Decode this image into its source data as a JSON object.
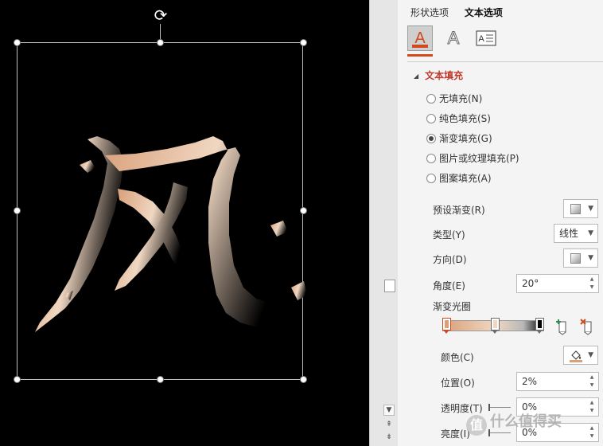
{
  "canvas": {
    "rotate_glyph": "⟳",
    "art_icon": "feng-calligraphy-art"
  },
  "pane": {
    "tabs": [
      {
        "label": "形状选项",
        "active": false
      },
      {
        "label": "文本选项",
        "active": true
      }
    ],
    "icon_tabs": [
      {
        "icon": "text-fill-outline-icon",
        "label": "A",
        "active": true
      },
      {
        "icon": "text-effects-icon",
        "label": "A",
        "active": false
      },
      {
        "icon": "text-box-icon",
        "label": "A",
        "active": false
      }
    ],
    "section": {
      "title": "文本填充",
      "expanded": true
    },
    "fill_options": [
      {
        "label": "无填充(N)",
        "checked": false
      },
      {
        "label": "纯色填充(S)",
        "checked": false
      },
      {
        "label": "渐变填充(G)",
        "checked": true
      },
      {
        "label": "图片或纹理填充(P)",
        "checked": false
      },
      {
        "label": "图案填充(A)",
        "checked": false
      }
    ],
    "preset_label": "预设渐变(R)",
    "type_label": "类型(Y)",
    "type_value": "线性",
    "direction_label": "方向(D)",
    "angle_label": "角度(E)",
    "angle_value": "20°",
    "stops_label": "渐变光圈",
    "gradient_stops": [
      {
        "position": 0.0,
        "color": "#d9a07a",
        "selected": true
      },
      {
        "position": 0.52,
        "color": "#f0d7c2",
        "selected": false
      },
      {
        "position": 1.0,
        "color": "#000000",
        "selected": false
      }
    ],
    "add_stop_icon": "add-gradient-stop-icon",
    "remove_stop_icon": "remove-gradient-stop-icon",
    "color_label": "颜色(C)",
    "position_label": "位置(O)",
    "position_value": "2%",
    "transparency_label": "透明度(T)",
    "transparency_value": "0%",
    "transparency_level": 0,
    "brightness_label": "亮度(I)",
    "brightness_value": "0%",
    "brightness_level": 0
  },
  "colors": {
    "accent": "#d04a1d",
    "section_title": "#c0392b",
    "text_fill_start": "#d9a07a",
    "text_fill_mid": "#f0d7c2",
    "text_fill_end": "#000000"
  },
  "watermark": {
    "logo": "值",
    "text": "什么值得买"
  }
}
